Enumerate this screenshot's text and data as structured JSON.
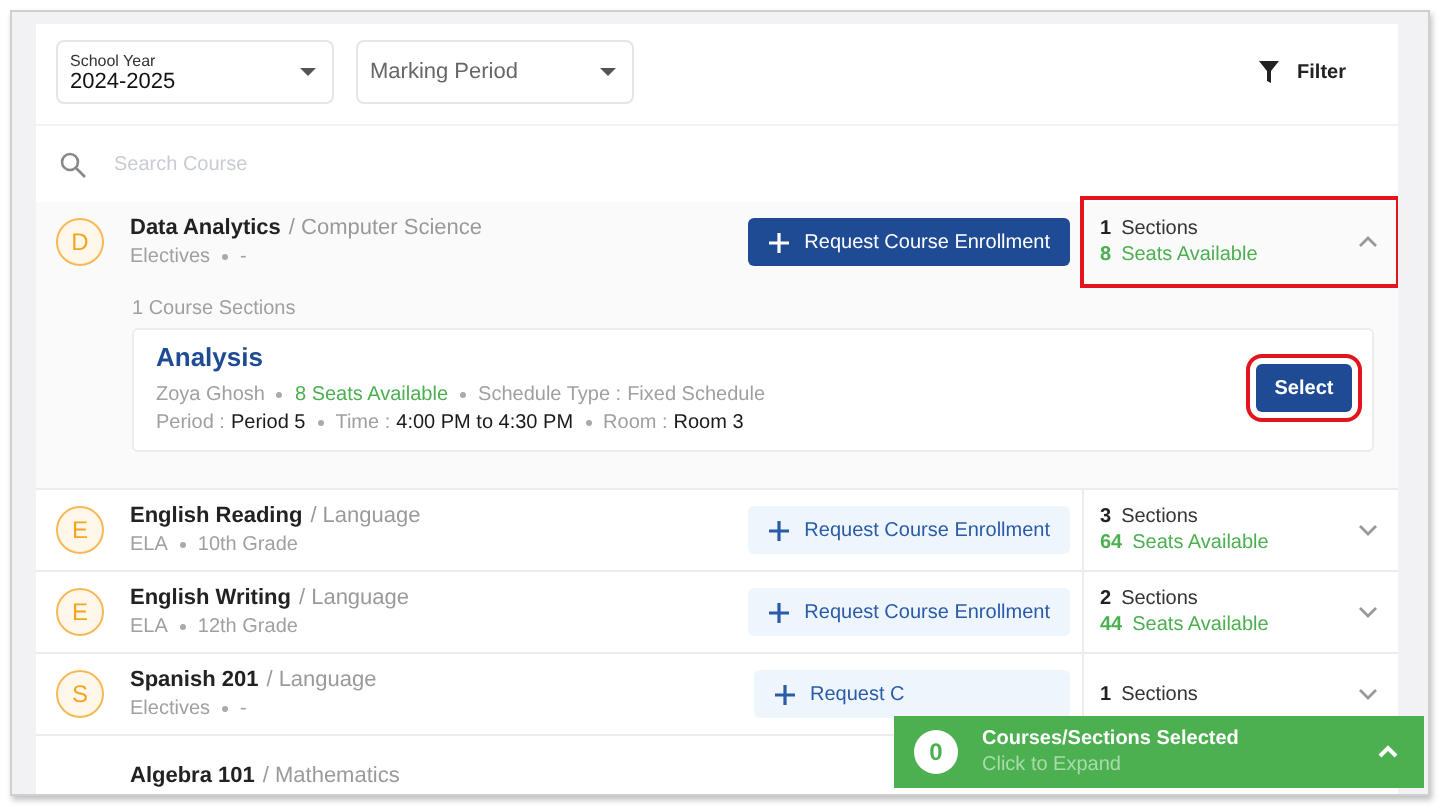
{
  "filters": {
    "school_year": {
      "label": "School Year",
      "value": "2024-2025"
    },
    "marking_period": {
      "placeholder": "Marking Period"
    },
    "filter_button": "Filter"
  },
  "search": {
    "placeholder": "Search Course"
  },
  "courses": [
    {
      "initial": "D",
      "name": "Data Analytics",
      "subject": "/ Computer Science",
      "category": "Electives",
      "grade": "-",
      "request_label": "Request Course Enrollment",
      "sections_count": "1",
      "sections_label": "Sections",
      "seats_count": "8",
      "seats_label": "Seats Available",
      "expanded": true,
      "highlighted": true,
      "sections_title": "1 Course Sections",
      "sections": [
        {
          "title": "Analysis",
          "teacher": "Zoya Ghosh",
          "seats": "8 Seats Available",
          "schedule_label": "Schedule Type :",
          "schedule_value": "Fixed Schedule",
          "period_label": "Period :",
          "period": "Period 5",
          "time_label": "Time :",
          "time": "4:00 PM to 4:30 PM",
          "room_label": "Room :",
          "room": "Room 3",
          "button": "Select",
          "highlighted": true
        }
      ]
    },
    {
      "initial": "E",
      "name": "English Reading",
      "subject": "/ Language",
      "category": "ELA",
      "grade": "10th Grade",
      "request_label": "Request Course Enrollment",
      "sections_count": "3",
      "sections_label": "Sections",
      "seats_count": "64",
      "seats_label": "Seats Available",
      "expanded": false,
      "highlighted": false
    },
    {
      "initial": "E",
      "name": "English Writing",
      "subject": "/ Language",
      "category": "ELA",
      "grade": "12th Grade",
      "request_label": "Request Course Enrollment",
      "sections_count": "2",
      "sections_label": "Sections",
      "seats_count": "44",
      "seats_label": "Seats Available",
      "expanded": false,
      "highlighted": false
    },
    {
      "initial": "S",
      "name": "Spanish 201",
      "subject": "/ Language",
      "category": "Electives",
      "grade": "-",
      "request_label": "Request C",
      "sections_count": "1",
      "sections_label": "Sections",
      "expanded": false,
      "highlighted": false
    },
    {
      "name": "Algebra 101",
      "subject": "/ Mathematics"
    }
  ],
  "toast": {
    "count": "0",
    "title": "Courses/Sections Selected",
    "subtitle": "Click to Expand",
    "expanded": false
  }
}
